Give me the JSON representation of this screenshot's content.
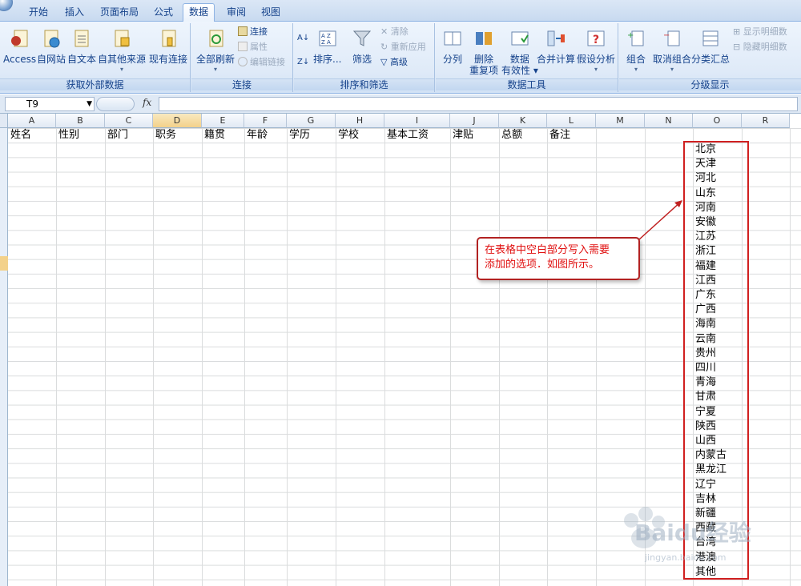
{
  "ribbon_tabs": [
    {
      "label": "开始",
      "active": false
    },
    {
      "label": "插入",
      "active": false
    },
    {
      "label": "页面布局",
      "active": false
    },
    {
      "label": "公式",
      "active": false
    },
    {
      "label": "数据",
      "active": true
    },
    {
      "label": "审阅",
      "active": false
    },
    {
      "label": "视图",
      "active": false
    }
  ],
  "groups": {
    "external": {
      "label": "获取外部数据",
      "access": "Access",
      "web": "自网站",
      "text": "自文本",
      "other": "自其他来源",
      "existing": "现有连接"
    },
    "connections": {
      "label": "连接",
      "refresh_all": "全部刷新",
      "connections": "连接",
      "properties": "属性",
      "edit_links": "编辑链接"
    },
    "sort_filter": {
      "label": "排序和筛选",
      "sort": "排序...",
      "filter": "筛选",
      "clear": "清除",
      "reapply": "重新应用",
      "advanced": "高级",
      "az_icon": "A/Z"
    },
    "tools": {
      "label": "数据工具",
      "text_to_columns": "分列",
      "remove_dup_1": "删除",
      "remove_dup_2": "重复项",
      "validation_1": "数据",
      "validation_2": "有效性",
      "consolidate": "合并计算",
      "what_if": "假设分析"
    },
    "outline": {
      "label": "分级显示",
      "group": "组合",
      "ungroup": "取消组合",
      "subtotal": "分类汇总",
      "show_detail": "显示明细数",
      "hide_detail": "隐藏明细数"
    }
  },
  "formula_bar": {
    "name_box": "T9",
    "fx": "fx",
    "value": ""
  },
  "columns": [
    "A",
    "B",
    "C",
    "D",
    "E",
    "F",
    "G",
    "H",
    "I",
    "J",
    "K",
    "L",
    "M",
    "N",
    "O",
    "R"
  ],
  "headers_row": [
    "姓名",
    "性别",
    "部门",
    "职务",
    "籍贯",
    "年龄",
    "学历",
    "学校",
    "基本工资",
    "津贴",
    "总额",
    "备注"
  ],
  "province_list": [
    "北京",
    "天津",
    "河北",
    "山东",
    "河南",
    "安徽",
    "江苏",
    "浙江",
    "福建",
    "江西",
    "广东",
    "广西",
    "海南",
    "云南",
    "贵州",
    "四川",
    "青海",
    "甘肃",
    "宁夏",
    "陕西",
    "山西",
    "内蒙古",
    "黑龙江",
    "辽宁",
    "吉林",
    "新疆",
    "西藏",
    "台湾",
    "港澳",
    "其他"
  ],
  "callout": {
    "line1": "在表格中空白部分写入需要",
    "line2": "添加的选项．如图所示。",
    "color": "#e01010"
  },
  "watermark": {
    "brand": "Baidu经验",
    "url": "jingyan.baidu.com"
  }
}
